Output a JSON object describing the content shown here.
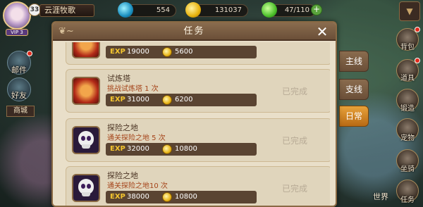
{
  "player": {
    "name": "云涯牧歌",
    "level": "33",
    "vip": "VIP 3"
  },
  "resources": [
    {
      "icon": "gem-icon",
      "value": "554"
    },
    {
      "icon": "gold-coin-icon",
      "value": "131037"
    },
    {
      "icon": "energy-icon",
      "value": "47/110"
    }
  ],
  "left_menu": {
    "mail": "邮件",
    "friends": "好友",
    "shop": "商城"
  },
  "right_menu": {
    "backpack": "背包",
    "items": "道具",
    "forge": "锻造",
    "pets": "宠物",
    "mount": "坐骑",
    "tasks": "任务",
    "world": "世界"
  },
  "panel": {
    "title": "任务",
    "tabs": [
      "主线",
      "支线",
      "日常"
    ],
    "active_tab": "日常",
    "tasks": [
      {
        "title": "",
        "desc": "",
        "exp_label": "EXP",
        "exp": "19000",
        "gold": "5600",
        "status": ""
      },
      {
        "title": "试炼塔",
        "desc": "挑战试炼塔 1 次",
        "exp_label": "EXP",
        "exp": "31000",
        "gold": "6200",
        "status": "已完成"
      },
      {
        "title": "探险之地",
        "desc": "通关探险之地 5 次",
        "exp_label": "EXP",
        "exp": "32000",
        "gold": "10800",
        "status": "已完成"
      },
      {
        "title": "探险之地",
        "desc": "通关探险之地10 次",
        "exp_label": "EXP",
        "exp": "38000",
        "gold": "10800",
        "status": "已完成"
      }
    ]
  }
}
